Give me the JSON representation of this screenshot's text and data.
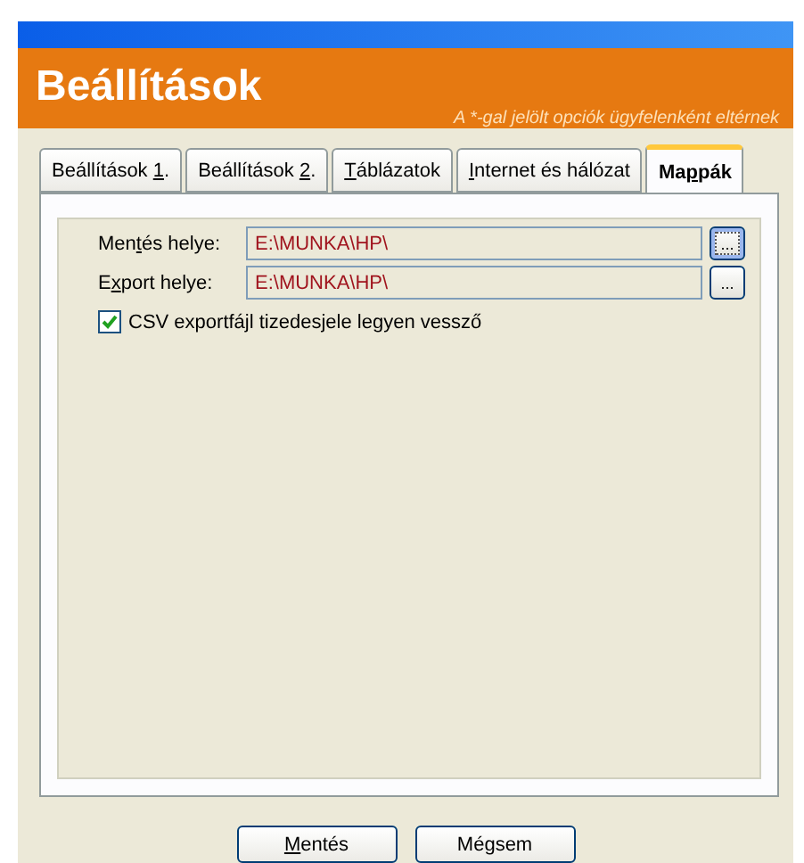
{
  "header": {
    "title": "Beállítások",
    "subtitle": "A *-gal jelölt opciók ügyfelenként eltérnek"
  },
  "tabs": [
    {
      "label": {
        "pre": "Beállítások ",
        "key": "1",
        "post": "."
      },
      "selected": false
    },
    {
      "label": {
        "pre": "Beállítások ",
        "key": "2",
        "post": "."
      },
      "selected": false
    },
    {
      "label": {
        "key": "T",
        "post": "áblázatok"
      },
      "selected": false
    },
    {
      "label": {
        "key": "I",
        "post": "nternet és hálózat"
      },
      "selected": false
    },
    {
      "label": {
        "pre": "Ma",
        "key": "p",
        "post": "pák"
      },
      "selected": true
    }
  ],
  "fields": [
    {
      "label": {
        "pre": "Men",
        "key": "t",
        "post": "és helye:"
      },
      "value": "E:\\MUNKA\\HP\\",
      "browse": "...",
      "focused": true
    },
    {
      "label": {
        "pre": "E",
        "key": "x",
        "post": "port helye:"
      },
      "value": "E:\\MUNKA\\HP\\",
      "browse": "...",
      "focused": false
    }
  ],
  "checkbox": {
    "label": "CSV exportfájl tizedesjele legyen vessző",
    "checked": true
  },
  "buttons": [
    {
      "label": {
        "key": "M",
        "post": "entés"
      }
    },
    {
      "label": {
        "pre": "Mé",
        "key": "g",
        "post": "sem"
      }
    }
  ]
}
